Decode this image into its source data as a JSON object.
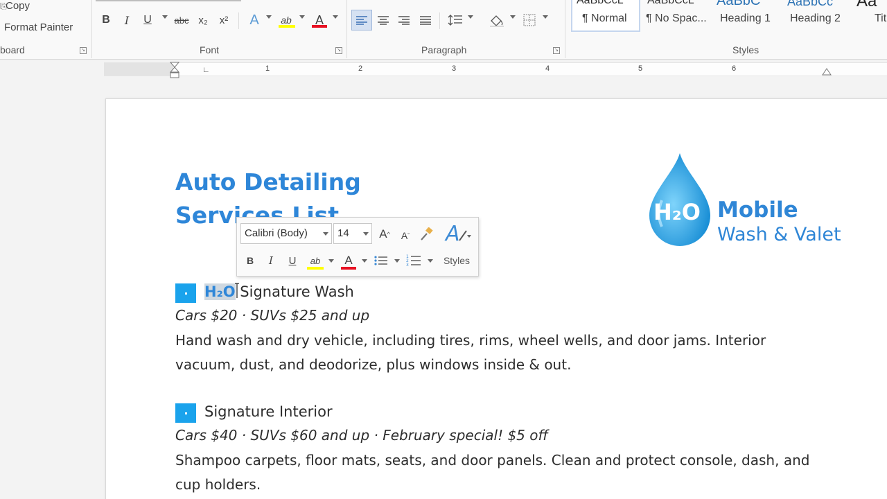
{
  "ribbon": {
    "clipboard": {
      "copy_label": "Copy",
      "format_painter_label": "Format Painter",
      "group_label": "board"
    },
    "font": {
      "group_label": "Font",
      "bold": "B",
      "italic": "I",
      "underline": "U",
      "strikethrough": "abc",
      "subscript": "x₂",
      "superscript": "x²",
      "text_effects": "A",
      "highlight": "ab",
      "font_color": "A"
    },
    "paragraph": {
      "group_label": "Paragraph"
    },
    "styles": {
      "group_label": "Styles",
      "items": [
        "¶ Normal",
        "¶ No Spac...",
        "Heading 1",
        "Heading 2",
        "Tit"
      ],
      "previews": [
        "AaBbCcL",
        "AaBbCcL",
        "AaBbC",
        "AaBbCc",
        "Aa"
      ]
    }
  },
  "ruler": {
    "numbers": [
      "1",
      "2",
      "3",
      "4",
      "5",
      "6"
    ]
  },
  "document": {
    "title_line1": "Auto Detailing",
    "title_line2": "Services List",
    "logo": {
      "h2o": "H₂O",
      "mobile": "Mobile",
      "wash": "Wash & Valet"
    },
    "services": [
      {
        "name_highlight": "H₂O",
        "name_rest": " Signature Wash",
        "price": "Cars $20 · SUVs $25 and up",
        "description": "Hand wash and dry vehicle, including tires, rims, wheel wells, and door jams. Interior vacuum, dust, and deodorize, plus windows inside & out."
      },
      {
        "name": "Signature Interior",
        "price": "Cars $40 · SUVs $60 and up · February special! $5 off",
        "description": "Shampoo carpets, floor mats, seats, and door panels. Clean and protect console, dash, and cup holders."
      }
    ]
  },
  "mini_toolbar": {
    "font_name": "Calibri (Body)",
    "font_size": "14",
    "grow": "A",
    "shrink": "A",
    "bold": "B",
    "italic": "I",
    "underline": "U",
    "styles_label": "Styles"
  },
  "colors": {
    "accent": "#2e86d8",
    "bullet": "#1aa3ec",
    "font_color_bar": "#e81123",
    "highlight_bar": "#ffff00"
  }
}
